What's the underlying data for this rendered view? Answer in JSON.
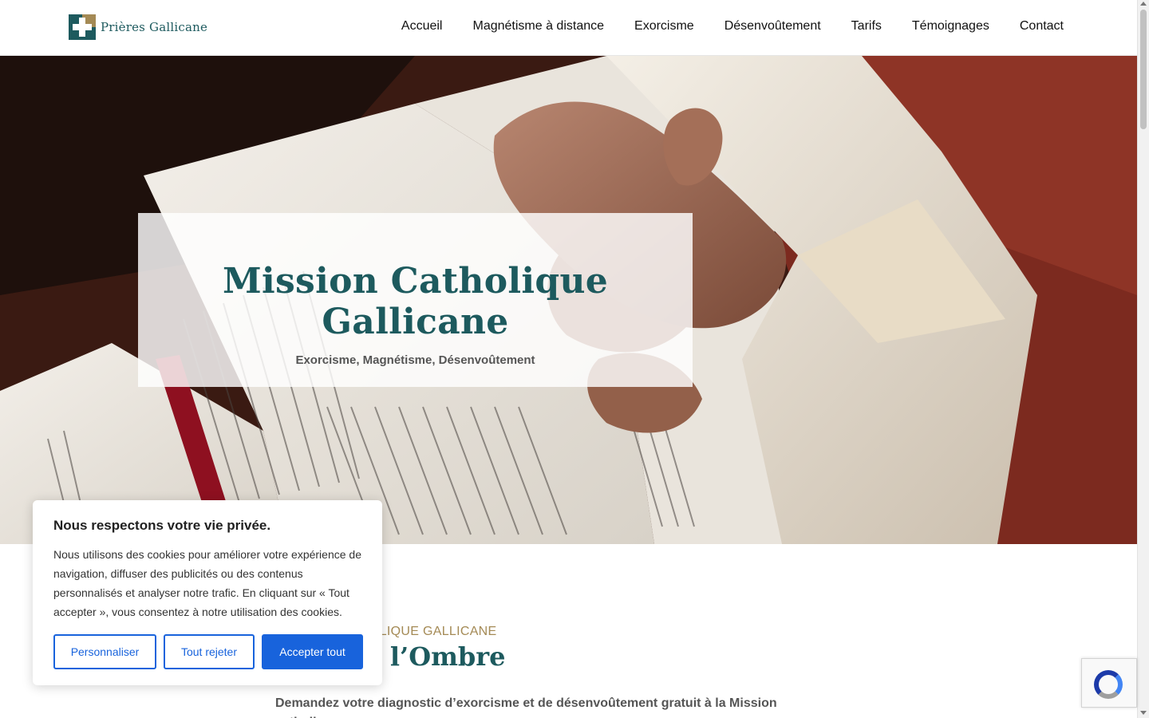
{
  "brand": {
    "logo_text": "Prières Gallicane",
    "accent_color": "#1d5a5e",
    "gold_color": "#a48a55"
  },
  "nav": {
    "items": [
      {
        "label": "Accueil"
      },
      {
        "label": "Magnétisme à distance"
      },
      {
        "label": "Exorcisme"
      },
      {
        "label": "Désenvoûtement"
      },
      {
        "label": "Tarifs"
      },
      {
        "label": "Témoignages"
      },
      {
        "label": "Contact"
      }
    ]
  },
  "hero": {
    "title": "Mission Catholique Gallicane",
    "subtitle": "Exorcisme, Magnétisme, Désenvoûtement"
  },
  "section": {
    "kicker": "MISSION CATHOLIQUE GALLICANE",
    "title": "re dans l’Ombre",
    "body": "Demandez votre diagnostic d’exorcisme et de désenvoûtement gratuit à la Mission catholique"
  },
  "cookie": {
    "title": "Nous respectons votre vie privée.",
    "text": "Nous utilisons des cookies pour améliorer votre expérience de navigation, diffuser des publicités ou des contenus personnalisés et analyser notre trafic. En cliquant sur « Tout accepter », vous consentez à notre utilisation des cookies.",
    "customize_label": "Personnaliser",
    "reject_label": "Tout rejeter",
    "accept_label": "Accepter tout",
    "button_color": "#1863dc"
  }
}
